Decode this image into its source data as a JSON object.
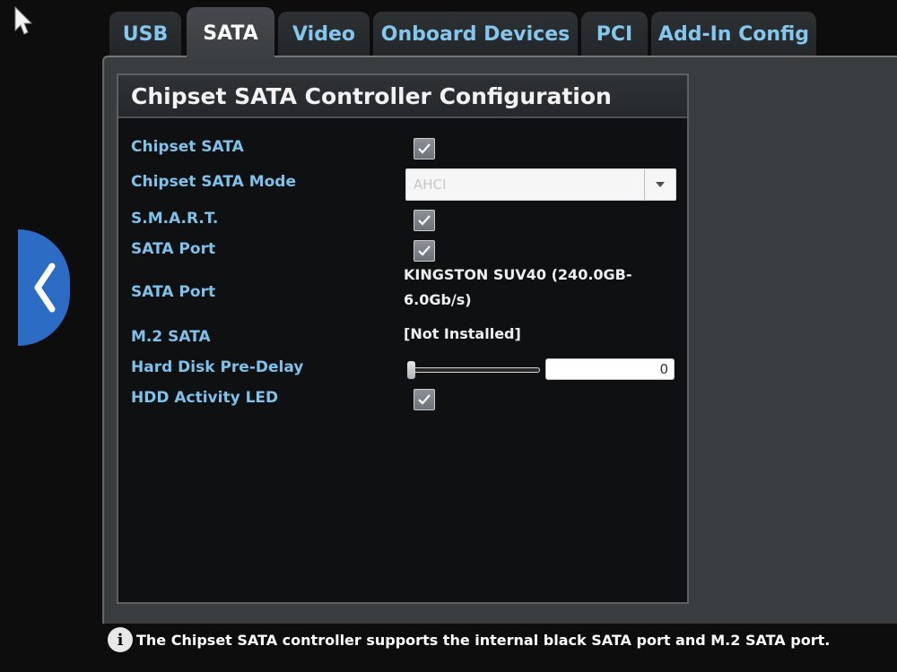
{
  "tabs": [
    {
      "label": "USB",
      "active": false
    },
    {
      "label": "SATA",
      "active": true
    },
    {
      "label": "Video",
      "active": false
    },
    {
      "label": "Onboard Devices",
      "active": false
    },
    {
      "label": "PCI",
      "active": false
    },
    {
      "label": "Add-In Config",
      "active": false
    }
  ],
  "section": {
    "title": "Chipset SATA Controller Configuration"
  },
  "settings": {
    "chipset_sata": {
      "label": "Chipset SATA",
      "checked": true
    },
    "chipset_sata_mode": {
      "label": "Chipset SATA Mode",
      "value": "AHCI"
    },
    "smart": {
      "label": "S.M.A.R.T.",
      "checked": true
    },
    "sata_port_enable": {
      "label": "SATA Port",
      "checked": true
    },
    "sata_port_device": {
      "label": "SATA Port",
      "value_line1": "KINGSTON SUV40 (240.0GB-",
      "value_line2": "6.0Gb/s)"
    },
    "m2_sata": {
      "label": "M.2 SATA",
      "value": "[Not Installed]"
    },
    "hard_disk_pre_delay": {
      "label": "Hard Disk Pre-Delay",
      "value": "0",
      "slider_fraction": 0.0
    },
    "hdd_activity_led": {
      "label": "HDD Activity LED",
      "checked": true
    }
  },
  "info_bar": {
    "icon": "info-icon",
    "text": "The Chipset SATA controller supports the internal black SATA port and M.2 SATA port."
  },
  "colors": {
    "label_blue": "#7ec1ea",
    "back_button": "#2c6cc4",
    "background": "#0d0d0e"
  }
}
